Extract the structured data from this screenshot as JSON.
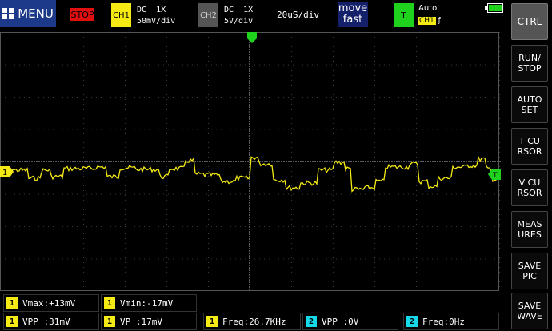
{
  "header": {
    "menu_label": "MENU",
    "stop_label": "STOP",
    "ch1": {
      "badge": "CH1",
      "coupling": "DC  1X",
      "scale": "50mV/div"
    },
    "ch2": {
      "badge": "CH2",
      "coupling": "DC  1X",
      "scale": "5V/div"
    },
    "timebase": "20uS/div",
    "move_line1": "move",
    "move_line2": "fast",
    "trigger": {
      "badge": "T",
      "mode": "Auto",
      "source": "CH1",
      "edge_symbol": "ƒ"
    },
    "battery_level": 1.0
  },
  "sidebar": {
    "buttons": [
      {
        "label": "CTRL"
      },
      {
        "label": "RUN/\nSTOP"
      },
      {
        "label": "AUTO\nSET"
      },
      {
        "label": "T CU\nRSOR"
      },
      {
        "label": "V CU\nRSOR"
      },
      {
        "label": "MEAS\nURES"
      },
      {
        "label": "SAVE\nPIC"
      },
      {
        "label": "SAVE\nWAVE"
      }
    ]
  },
  "screen": {
    "ch1_marker": "1",
    "trigger_marker": "T"
  },
  "measurements": {
    "row1": [
      {
        "ch": "1",
        "label": "Vmax:",
        "value": "+13mV"
      },
      {
        "ch": "1",
        "label": "Vmin:",
        "value": "-17mV"
      }
    ],
    "row2": [
      {
        "ch": "1",
        "label": "VPP :",
        "value": "31mV"
      },
      {
        "ch": "1",
        "label": "VP  :",
        "value": "17mV"
      },
      {
        "ch": "1",
        "label": "Freq:",
        "value": "26.7KHz"
      },
      {
        "ch": "2",
        "label": "VPP :",
        "value": "0V"
      },
      {
        "ch": "2",
        "label": "Freq:",
        "value": "0Hz"
      }
    ]
  },
  "colors": {
    "ch1": "#f5ea14",
    "ch2": "#15d8e8",
    "trigger": "#1ed21e",
    "grid": "#3a3a3a"
  }
}
